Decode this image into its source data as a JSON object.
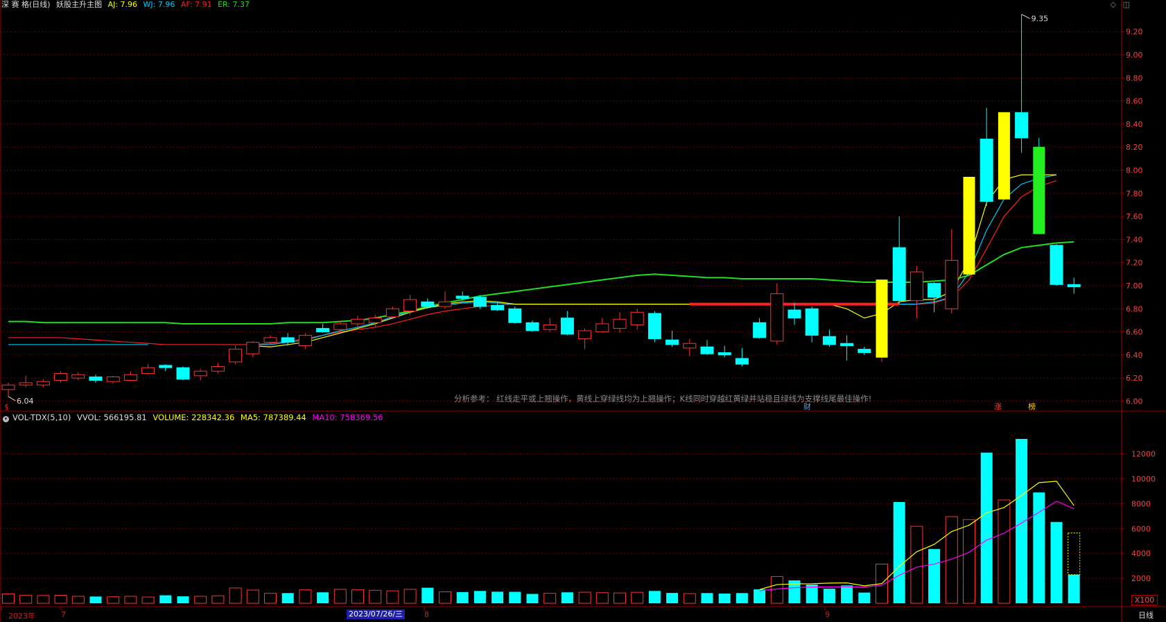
{
  "legend": {
    "name": "深 赛 格(日线)",
    "indicator": "妖股主升主图",
    "aj": "AJ: 7.96",
    "wj": "WJ: 7.96",
    "af": "AF: 7.91",
    "er": "ER: 7.37"
  },
  "vol_legend": {
    "name": "VOL-TDX(5,10)",
    "vvol": "VVOL: 566195.81",
    "volume": "VOLUME: 228342.36",
    "ma5": "MA5: 787389.44",
    "ma10": "MA10: 758369.56"
  },
  "top_icons": [
    "◇",
    "◫"
  ],
  "annotation": "分析参考： 红线走平或上翘操作，黄线上穿绿线均为上翘操作；K线同时穿越红黄绿并站稳且绿线为支撑线尾最佳操作!",
  "marks": {
    "s": "§",
    "cai": "财",
    "zhang": "涨",
    "bang": "榜"
  },
  "dates": {
    "year": "2023年",
    "m7": "7",
    "selected": "2023/07/26/三",
    "m8": "8",
    "m9": "9"
  },
  "period": "日线",
  "vol_unit": "X100",
  "colors": {
    "up": "#ff3232",
    "down": "#00ffff",
    "ma_green": "#22dd22",
    "ma_yellow": "#ffff00",
    "ma_cyan": "#00ccff",
    "ma_red": "#ff2020",
    "vol_ma10": "#ff00ff",
    "grid": "#6b0000"
  },
  "chart_data": [
    {
      "type": "candlestick",
      "y_ticks": [
        "6.00",
        "6.20",
        "6.40",
        "6.60",
        "6.80",
        "7.00",
        "7.20",
        "7.40",
        "7.60",
        "7.80",
        "8.00",
        "8.20",
        "8.40",
        "8.60",
        "8.80",
        "9.00",
        "9.20"
      ],
      "ylim": [
        5.95,
        9.4
      ],
      "max_label": "9.35",
      "min_label": "6.04",
      "candles": [
        {
          "o": 6.1,
          "c": 6.14,
          "h": 6.16,
          "l": 6.04
        },
        {
          "o": 6.14,
          "c": 6.16,
          "h": 6.22,
          "l": 6.12
        },
        {
          "o": 6.14,
          "c": 6.17,
          "h": 6.19,
          "l": 6.12
        },
        {
          "o": 6.18,
          "c": 6.24,
          "h": 6.26,
          "l": 6.16
        },
        {
          "o": 6.2,
          "c": 6.23,
          "h": 6.25,
          "l": 6.18
        },
        {
          "o": 6.21,
          "c": 6.18,
          "h": 6.23,
          "l": 6.16
        },
        {
          "o": 6.17,
          "c": 6.21,
          "h": 6.22,
          "l": 6.15
        },
        {
          "o": 6.18,
          "c": 6.23,
          "h": 6.26,
          "l": 6.17
        },
        {
          "o": 6.24,
          "c": 6.29,
          "h": 6.32,
          "l": 6.23
        },
        {
          "o": 6.31,
          "c": 6.29,
          "h": 6.32,
          "l": 6.26
        },
        {
          "o": 6.29,
          "c": 6.19,
          "h": 6.3,
          "l": 6.18
        },
        {
          "o": 6.22,
          "c": 6.26,
          "h": 6.28,
          "l": 6.18
        },
        {
          "o": 6.26,
          "c": 6.3,
          "h": 6.33,
          "l": 6.24
        },
        {
          "o": 6.34,
          "c": 6.45,
          "h": 6.48,
          "l": 6.32
        },
        {
          "o": 6.41,
          "c": 6.51,
          "h": 6.52,
          "l": 6.38
        },
        {
          "o": 6.51,
          "c": 6.55,
          "h": 6.57,
          "l": 6.49
        },
        {
          "o": 6.55,
          "c": 6.51,
          "h": 6.59,
          "l": 6.48
        },
        {
          "o": 6.48,
          "c": 6.57,
          "h": 6.59,
          "l": 6.45
        },
        {
          "o": 6.63,
          "c": 6.6,
          "h": 6.67,
          "l": 6.59
        },
        {
          "o": 6.62,
          "c": 6.67,
          "h": 6.7,
          "l": 6.6
        },
        {
          "o": 6.67,
          "c": 6.71,
          "h": 6.74,
          "l": 6.64
        },
        {
          "o": 6.68,
          "c": 6.72,
          "h": 6.75,
          "l": 6.64
        },
        {
          "o": 6.73,
          "c": 6.8,
          "h": 6.82,
          "l": 6.71
        },
        {
          "o": 6.78,
          "c": 6.88,
          "h": 6.92,
          "l": 6.75
        },
        {
          "o": 6.86,
          "c": 6.82,
          "h": 6.89,
          "l": 6.8
        },
        {
          "o": 6.82,
          "c": 6.86,
          "h": 6.95,
          "l": 6.8
        },
        {
          "o": 6.91,
          "c": 6.89,
          "h": 6.95,
          "l": 6.87
        },
        {
          "o": 6.9,
          "c": 6.82,
          "h": 6.92,
          "l": 6.8
        },
        {
          "o": 6.83,
          "c": 6.79,
          "h": 6.86,
          "l": 6.78
        },
        {
          "o": 6.8,
          "c": 6.68,
          "h": 6.82,
          "l": 6.67
        },
        {
          "o": 6.68,
          "c": 6.61,
          "h": 6.7,
          "l": 6.6
        },
        {
          "o": 6.62,
          "c": 6.66,
          "h": 6.72,
          "l": 6.6
        },
        {
          "o": 6.72,
          "c": 6.58,
          "h": 6.78,
          "l": 6.57
        },
        {
          "o": 6.54,
          "c": 6.61,
          "h": 6.63,
          "l": 6.45
        },
        {
          "o": 6.6,
          "c": 6.67,
          "h": 6.72,
          "l": 6.59
        },
        {
          "o": 6.63,
          "c": 6.71,
          "h": 6.77,
          "l": 6.59
        },
        {
          "o": 6.66,
          "c": 6.77,
          "h": 6.8,
          "l": 6.62
        },
        {
          "o": 6.76,
          "c": 6.54,
          "h": 6.78,
          "l": 6.51
        },
        {
          "o": 6.53,
          "c": 6.49,
          "h": 6.61,
          "l": 6.47
        },
        {
          "o": 6.46,
          "c": 6.5,
          "h": 6.54,
          "l": 6.39
        },
        {
          "o": 6.47,
          "c": 6.41,
          "h": 6.53,
          "l": 6.4
        },
        {
          "o": 6.42,
          "c": 6.4,
          "h": 6.48,
          "l": 6.38
        },
        {
          "o": 6.37,
          "c": 6.32,
          "h": 6.46,
          "l": 6.3
        },
        {
          "o": 6.68,
          "c": 6.55,
          "h": 6.72,
          "l": 6.54
        },
        {
          "o": 6.52,
          "c": 6.93,
          "h": 7.02,
          "l": 6.49
        },
        {
          "o": 6.79,
          "c": 6.72,
          "h": 6.85,
          "l": 6.66
        },
        {
          "o": 6.8,
          "c": 6.57,
          "h": 6.82,
          "l": 6.51
        },
        {
          "o": 6.56,
          "c": 6.49,
          "h": 6.62,
          "l": 6.47
        },
        {
          "o": 6.5,
          "c": 6.48,
          "h": 6.57,
          "l": 6.35
        },
        {
          "o": 6.45,
          "c": 6.42,
          "h": 6.47,
          "l": 6.4
        },
        {
          "o": 6.38,
          "c": 7.05,
          "h": 7.05,
          "l": 6.34,
          "hl": "yellow"
        },
        {
          "o": 7.33,
          "c": 6.87,
          "h": 7.6,
          "l": 6.84
        },
        {
          "o": 6.87,
          "c": 7.12,
          "h": 7.17,
          "l": 6.72
        },
        {
          "o": 7.02,
          "c": 6.9,
          "h": 7.03,
          "l": 6.77
        },
        {
          "o": 6.8,
          "c": 7.22,
          "h": 7.49,
          "l": 6.76
        },
        {
          "o": 7.1,
          "c": 7.94,
          "h": 7.94,
          "l": 7.09,
          "hl": "yellow"
        },
        {
          "o": 8.27,
          "c": 7.73,
          "h": 8.54,
          "l": 7.69
        },
        {
          "o": 7.75,
          "c": 8.5,
          "h": 8.5,
          "l": 7.75,
          "hl": "yellow"
        },
        {
          "o": 8.5,
          "c": 8.28,
          "h": 9.35,
          "l": 8.15
        },
        {
          "o": 8.2,
          "c": 7.45,
          "h": 8.28,
          "l": 7.45,
          "hl": "green"
        },
        {
          "o": 7.35,
          "c": 7.01,
          "h": 7.36,
          "l": 7.0
        },
        {
          "o": 7.01,
          "c": 6.99,
          "h": 7.07,
          "l": 6.93
        }
      ],
      "ma_green": [
        6.69,
        6.69,
        6.68,
        6.68,
        6.68,
        6.68,
        6.68,
        6.68,
        6.68,
        6.68,
        6.67,
        6.67,
        6.67,
        6.67,
        6.67,
        6.67,
        6.68,
        6.68,
        6.68,
        6.69,
        6.7,
        6.72,
        6.75,
        6.78,
        6.82,
        6.85,
        6.88,
        6.91,
        6.93,
        6.95,
        6.97,
        6.99,
        7.01,
        7.03,
        7.05,
        7.07,
        7.09,
        7.1,
        7.09,
        7.08,
        7.07,
        7.07,
        7.06,
        7.06,
        7.06,
        7.06,
        7.06,
        7.05,
        7.04,
        7.03,
        7.03,
        7.03,
        7.03,
        7.04,
        7.05,
        7.09,
        7.18,
        7.27,
        7.33,
        7.35,
        7.37,
        7.38
      ],
      "ma_yellow": [
        null,
        null,
        null,
        null,
        null,
        null,
        null,
        null,
        null,
        null,
        null,
        null,
        null,
        null,
        6.48,
        6.47,
        6.49,
        6.51,
        6.55,
        6.59,
        6.63,
        6.67,
        6.72,
        6.77,
        6.81,
        6.84,
        6.86,
        6.87,
        6.86,
        6.84,
        6.84,
        6.84,
        6.84,
        6.84,
        6.84,
        6.84,
        6.84,
        6.84,
        6.84,
        6.84,
        6.84,
        6.84,
        6.84,
        6.84,
        6.84,
        6.84,
        6.84,
        6.84,
        6.8,
        6.72,
        6.76,
        6.86,
        6.88,
        6.88,
        6.95,
        7.22,
        7.72,
        7.92,
        7.96,
        7.96,
        7.96
      ],
      "ma_cyan": [
        6.49,
        6.49,
        6.49,
        6.49,
        6.49,
        6.49,
        6.49,
        6.49,
        6.49,
        null,
        null,
        null,
        null,
        null,
        6.49,
        6.49,
        6.51,
        6.53,
        6.57,
        6.61,
        6.64,
        6.68,
        6.73,
        6.78,
        6.81,
        6.83,
        6.85,
        6.86,
        6.85,
        6.84,
        6.84,
        6.84,
        6.84,
        6.84,
        6.84,
        6.84,
        6.84,
        6.84,
        6.84,
        6.84,
        6.84,
        6.84,
        6.84,
        6.84,
        6.84,
        6.84,
        6.84,
        6.84,
        6.84,
        6.84,
        6.84,
        6.84,
        6.84,
        6.86,
        6.9,
        7.12,
        7.48,
        7.75,
        7.88,
        7.93,
        7.96
      ],
      "ma_red": [
        6.55,
        6.55,
        6.55,
        6.55,
        6.54,
        6.53,
        6.52,
        6.51,
        6.5,
        6.49,
        6.49,
        6.49,
        6.49,
        6.49,
        6.49,
        6.5,
        6.52,
        6.54,
        6.57,
        6.6,
        6.62,
        6.64,
        6.67,
        6.71,
        6.75,
        6.78,
        6.8,
        6.82,
        6.83,
        6.84,
        6.84,
        6.84,
        6.84,
        6.84,
        6.84,
        6.84,
        6.84,
        6.84,
        6.84,
        6.84,
        6.84,
        6.84,
        6.84,
        6.84,
        6.84,
        6.84,
        6.84,
        6.84,
        6.84,
        6.84,
        6.84,
        6.84,
        6.84,
        6.85,
        6.9,
        7.05,
        7.32,
        7.6,
        7.77,
        7.86,
        7.91
      ],
      "support_line": {
        "value": 6.84,
        "from_index": 39,
        "to_index": 51
      }
    },
    {
      "type": "bar",
      "y_ticks": [
        "2000",
        "4000",
        "6000",
        "8000",
        "10000",
        "12000"
      ],
      "ylim": [
        0,
        13700
      ],
      "volume": [
        750,
        650,
        620,
        640,
        560,
        540,
        520,
        560,
        500,
        640,
        560,
        560,
        600,
        1230,
        1060,
        800,
        820,
        1080,
        880,
        1120,
        1080,
        1040,
        1000,
        1120,
        1250,
        920,
        900,
        990,
        930,
        920,
        750,
        800,
        880,
        890,
        850,
        830,
        880,
        990,
        830,
        780,
        820,
        780,
        820,
        1120,
        2150,
        1840,
        1500,
        1170,
        1430,
        860,
        3150,
        8130,
        6180,
        4360,
        6960,
        6720,
        12100,
        8300,
        13200,
        8900,
        6530,
        2300
      ],
      "partial_volume": 5650,
      "ma5": [
        null,
        null,
        null,
        null,
        null,
        null,
        null,
        null,
        null,
        null,
        null,
        null,
        null,
        null,
        null,
        null,
        null,
        null,
        null,
        null,
        null,
        null,
        null,
        null,
        null,
        null,
        null,
        null,
        null,
        null,
        null,
        null,
        null,
        null,
        null,
        null,
        null,
        null,
        null,
        null,
        null,
        null,
        null,
        1100,
        1500,
        1560,
        1570,
        1620,
        1640,
        1400,
        1580,
        2960,
        4140,
        4730,
        5760,
        6270,
        7260,
        7690,
        8660,
        9690,
        9800,
        7850
      ],
      "ma10": [
        null,
        null,
        null,
        null,
        null,
        null,
        null,
        null,
        null,
        null,
        null,
        null,
        null,
        null,
        null,
        null,
        null,
        null,
        null,
        null,
        null,
        null,
        null,
        null,
        null,
        null,
        null,
        null,
        null,
        null,
        null,
        null,
        null,
        null,
        null,
        null,
        null,
        null,
        null,
        null,
        null,
        null,
        null,
        1000,
        1150,
        1250,
        1300,
        1310,
        1330,
        1300,
        1450,
        2250,
        2900,
        3150,
        3540,
        4100,
        5070,
        5630,
        6450,
        7310,
        8200,
        7600
      ]
    }
  ]
}
